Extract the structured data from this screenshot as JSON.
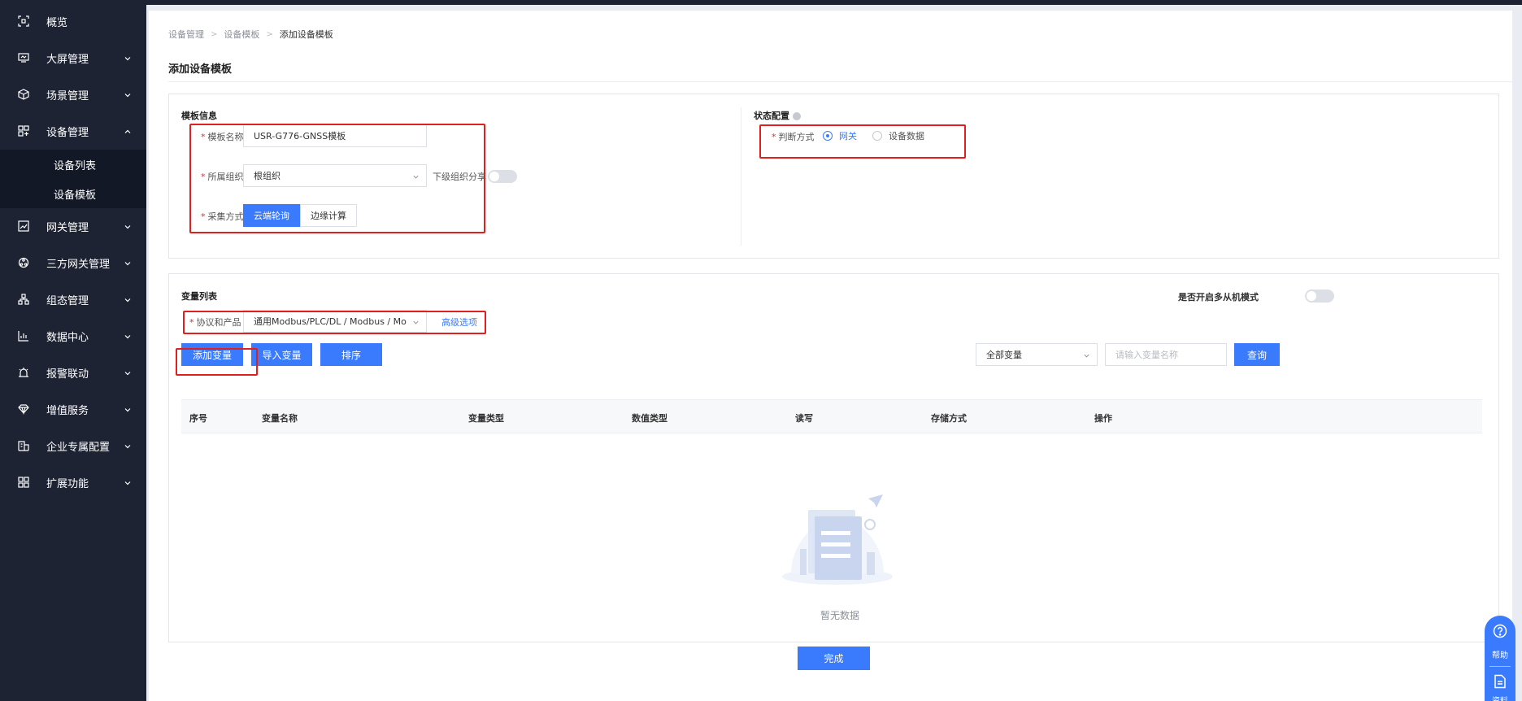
{
  "sidebar": {
    "items": [
      {
        "label": "概览",
        "icon": "scan-icon"
      },
      {
        "label": "大屏管理",
        "icon": "monitor-icon"
      },
      {
        "label": "场景管理",
        "icon": "cube-icon"
      },
      {
        "label": "设备管理",
        "icon": "device-icon"
      },
      {
        "label": "网关管理",
        "icon": "chart-icon"
      },
      {
        "label": "三方网关管理",
        "icon": "network-icon"
      },
      {
        "label": "组态管理",
        "icon": "flow-icon"
      },
      {
        "label": "数据中心",
        "icon": "bar-chart-icon"
      },
      {
        "label": "报警联动",
        "icon": "alarm-icon"
      },
      {
        "label": "增值服务",
        "icon": "diamond-icon"
      },
      {
        "label": "企业专属配置",
        "icon": "building-icon"
      },
      {
        "label": "扩展功能",
        "icon": "grid-icon"
      }
    ],
    "sub_items": [
      {
        "label": "设备列表"
      },
      {
        "label": "设备模板"
      }
    ]
  },
  "breadcrumb": [
    "设备管理",
    "设备模板",
    "添加设备模板"
  ],
  "page_title": "添加设备模板",
  "template_info": {
    "section_title": "模板信息",
    "name_label": "模板名称",
    "name_value": "USR-G776-GNSS模板",
    "org_label": "所属组织",
    "org_value": "根组织",
    "share_label": "下级组织分享",
    "method_label": "采集方式",
    "method_options": [
      "云端轮询",
      "边缘计算"
    ]
  },
  "status_config": {
    "section_title": "状态配置",
    "judge_label": "判断方式",
    "options": [
      "网关",
      "设备数据"
    ]
  },
  "variables": {
    "section_title": "变量列表",
    "multi_slave_label": "是否开启多从机模式",
    "protocol_label": "协议和产品",
    "protocol_value": "通用Modbus/PLC/DL / Modbus / Modbus RT",
    "advanced_link": "高级选项",
    "add_button": "添加变量",
    "import_button": "导入变量",
    "sort_button": "排序",
    "filter_value": "全部变量",
    "search_placeholder": "请输入变量名称",
    "query_button": "查询",
    "columns": [
      "序号",
      "变量名称",
      "变量类型",
      "数值类型",
      "读写",
      "存储方式",
      "操作"
    ],
    "empty_text": "暂无数据"
  },
  "finish_button": "完成",
  "float_help": {
    "help_label": "帮助",
    "doc_label": "资料"
  },
  "colors": {
    "primary": "#3a7bfd",
    "sidebar": "#1d2333",
    "highlight": "#e0201f"
  }
}
